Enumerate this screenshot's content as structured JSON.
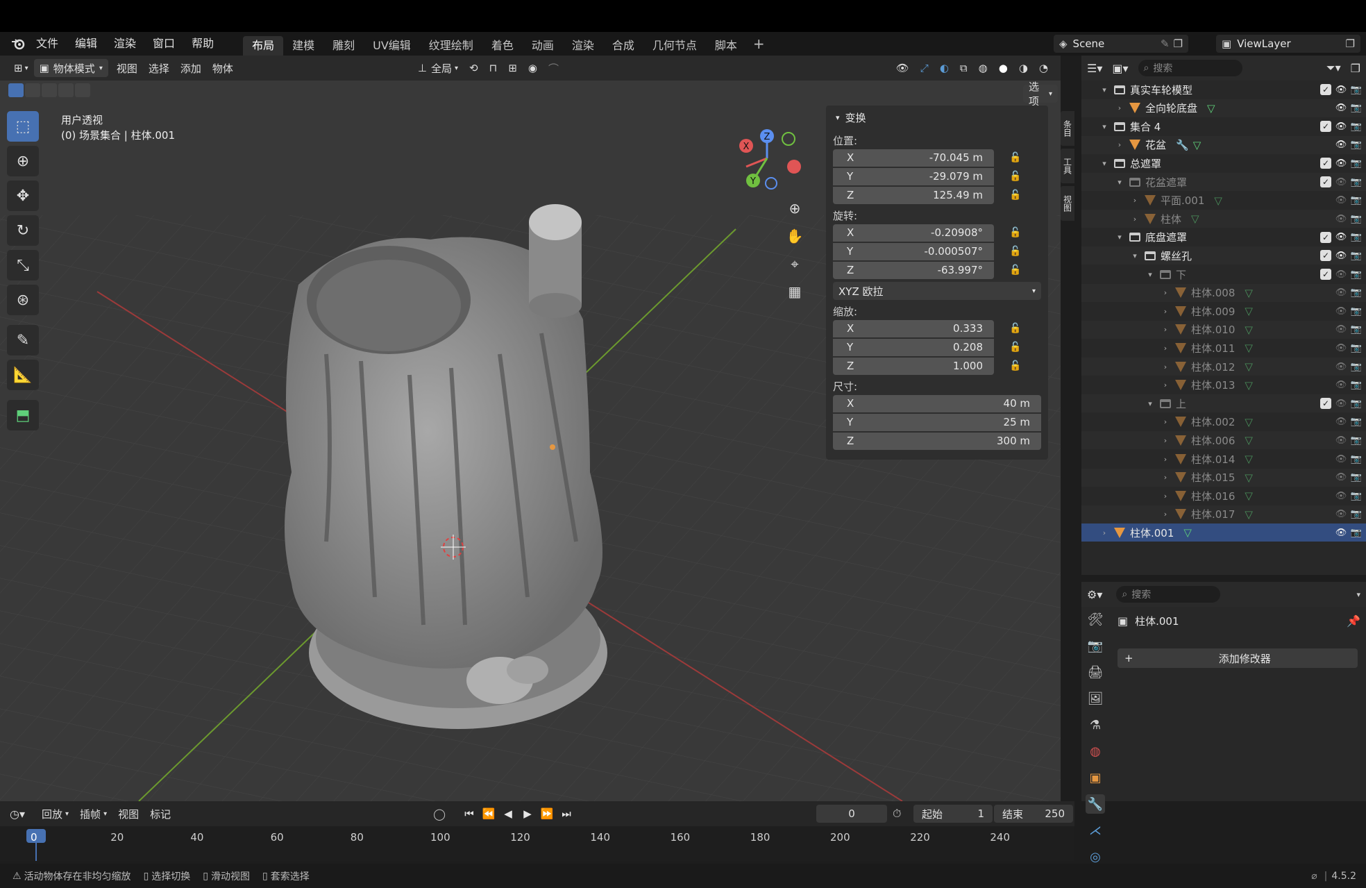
{
  "menubar": {
    "menus": [
      "文件",
      "编辑",
      "渲染",
      "窗口",
      "帮助"
    ],
    "workspaces": [
      "布局",
      "建模",
      "雕刻",
      "UV编辑",
      "纹理绘制",
      "着色",
      "动画",
      "渲染",
      "合成",
      "几何节点",
      "脚本"
    ],
    "active_workspace": "布局",
    "add_tab": "+",
    "scene": "Scene",
    "view_layer": "ViewLayer"
  },
  "viewport_header": {
    "mode": "物体模式",
    "menus": [
      "视图",
      "选择",
      "添加",
      "物体"
    ],
    "transform_orientation": "全局",
    "options": "选项"
  },
  "viewport": {
    "view_name": "用户透视",
    "collection_info": "(0) 场景集合 | 柱体.001",
    "gizmo": {
      "x": "X",
      "y": "Y",
      "z": "Z"
    }
  },
  "npanel": {
    "title": "变换",
    "location_label": "位置:",
    "location": {
      "x": "-70.045 m",
      "y": "-29.079 m",
      "z": "125.49 m"
    },
    "rotation_label": "旋转:",
    "rotation": {
      "x": "-0.20908°",
      "y": "-0.000507°",
      "z": "-63.997°"
    },
    "rotation_mode": "XYZ 欧拉",
    "scale_label": "缩放:",
    "scale": {
      "x": "0.333",
      "y": "0.208",
      "z": "1.000"
    },
    "dimensions_label": "尺寸:",
    "dimensions": {
      "x": "40 m",
      "y": "25 m",
      "z": "300 m"
    },
    "axis": {
      "x": "X",
      "y": "Y",
      "z": "Z"
    },
    "side_tabs": [
      "条目",
      "工具",
      "视图"
    ]
  },
  "outliner": {
    "search_placeholder": "搜索",
    "rows": [
      {
        "label": "真实车轮模型",
        "type": "collection",
        "indent": 0,
        "expanded": true,
        "dim": false,
        "checked": true
      },
      {
        "label": "全向轮底盘",
        "type": "mesh",
        "indent": 1,
        "expanded": false,
        "dim": false,
        "checked": null
      },
      {
        "label": "集合 4",
        "type": "collection",
        "indent": 0,
        "expanded": true,
        "dim": false,
        "checked": true
      },
      {
        "label": "花盆",
        "type": "mesh",
        "indent": 1,
        "expanded": false,
        "dim": false,
        "checked": null,
        "modifier": true
      },
      {
        "label": "总遮罩",
        "type": "collection",
        "indent": 0,
        "expanded": true,
        "dim": false,
        "checked": true
      },
      {
        "label": "花盆遮罩",
        "type": "collection",
        "indent": 1,
        "expanded": true,
        "dim": true,
        "checked": true
      },
      {
        "label": "平面.001",
        "type": "mesh",
        "indent": 2,
        "expanded": false,
        "dim": true,
        "checked": null
      },
      {
        "label": "柱体",
        "type": "mesh",
        "indent": 2,
        "expanded": false,
        "dim": true,
        "checked": null
      },
      {
        "label": "底盘遮罩",
        "type": "collection",
        "indent": 1,
        "expanded": true,
        "dim": false,
        "checked": true
      },
      {
        "label": "螺丝孔",
        "type": "collection",
        "indent": 2,
        "expanded": true,
        "dim": false,
        "checked": true
      },
      {
        "label": "下",
        "type": "collection",
        "indent": 3,
        "expanded": true,
        "dim": true,
        "checked": true
      },
      {
        "label": "柱体.008",
        "type": "mesh",
        "indent": 4,
        "expanded": false,
        "dim": true,
        "checked": null
      },
      {
        "label": "柱体.009",
        "type": "mesh",
        "indent": 4,
        "expanded": false,
        "dim": true,
        "checked": null
      },
      {
        "label": "柱体.010",
        "type": "mesh",
        "indent": 4,
        "expanded": false,
        "dim": true,
        "checked": null
      },
      {
        "label": "柱体.011",
        "type": "mesh",
        "indent": 4,
        "expanded": false,
        "dim": true,
        "checked": null
      },
      {
        "label": "柱体.012",
        "type": "mesh",
        "indent": 4,
        "expanded": false,
        "dim": true,
        "checked": null
      },
      {
        "label": "柱体.013",
        "type": "mesh",
        "indent": 4,
        "expanded": false,
        "dim": true,
        "checked": null
      },
      {
        "label": "上",
        "type": "collection",
        "indent": 3,
        "expanded": true,
        "dim": true,
        "checked": true
      },
      {
        "label": "柱体.002",
        "type": "mesh",
        "indent": 4,
        "expanded": false,
        "dim": true,
        "checked": null
      },
      {
        "label": "柱体.006",
        "type": "mesh",
        "indent": 4,
        "expanded": false,
        "dim": true,
        "checked": null
      },
      {
        "label": "柱体.014",
        "type": "mesh",
        "indent": 4,
        "expanded": false,
        "dim": true,
        "checked": null
      },
      {
        "label": "柱体.015",
        "type": "mesh",
        "indent": 4,
        "expanded": false,
        "dim": true,
        "checked": null
      },
      {
        "label": "柱体.016",
        "type": "mesh",
        "indent": 4,
        "expanded": false,
        "dim": true,
        "checked": null
      },
      {
        "label": "柱体.017",
        "type": "mesh",
        "indent": 4,
        "expanded": false,
        "dim": true,
        "checked": null
      },
      {
        "label": "柱体.001",
        "type": "mesh",
        "indent": 0,
        "expanded": false,
        "dim": false,
        "checked": null,
        "selected": true
      }
    ]
  },
  "properties": {
    "search_placeholder": "搜索",
    "object_name": "柱体.001",
    "add_modifier": "添加修改器",
    "add_modifier_plus": "+"
  },
  "timeline": {
    "menus": [
      "回放",
      "插帧",
      "视图",
      "标记"
    ],
    "current_frame": "0",
    "start_label": "起始",
    "start": "1",
    "end_label": "结束",
    "end": "250",
    "ruler": [
      "0",
      "20",
      "40",
      "60",
      "80",
      "100",
      "120",
      "140",
      "160",
      "180",
      "200",
      "220",
      "240"
    ]
  },
  "statusbar": {
    "warning": "活动物体存在非均匀缩放",
    "select": "选择切换",
    "pan": "滑动视图",
    "lasso": "套索选择",
    "version": "4.5.2"
  }
}
